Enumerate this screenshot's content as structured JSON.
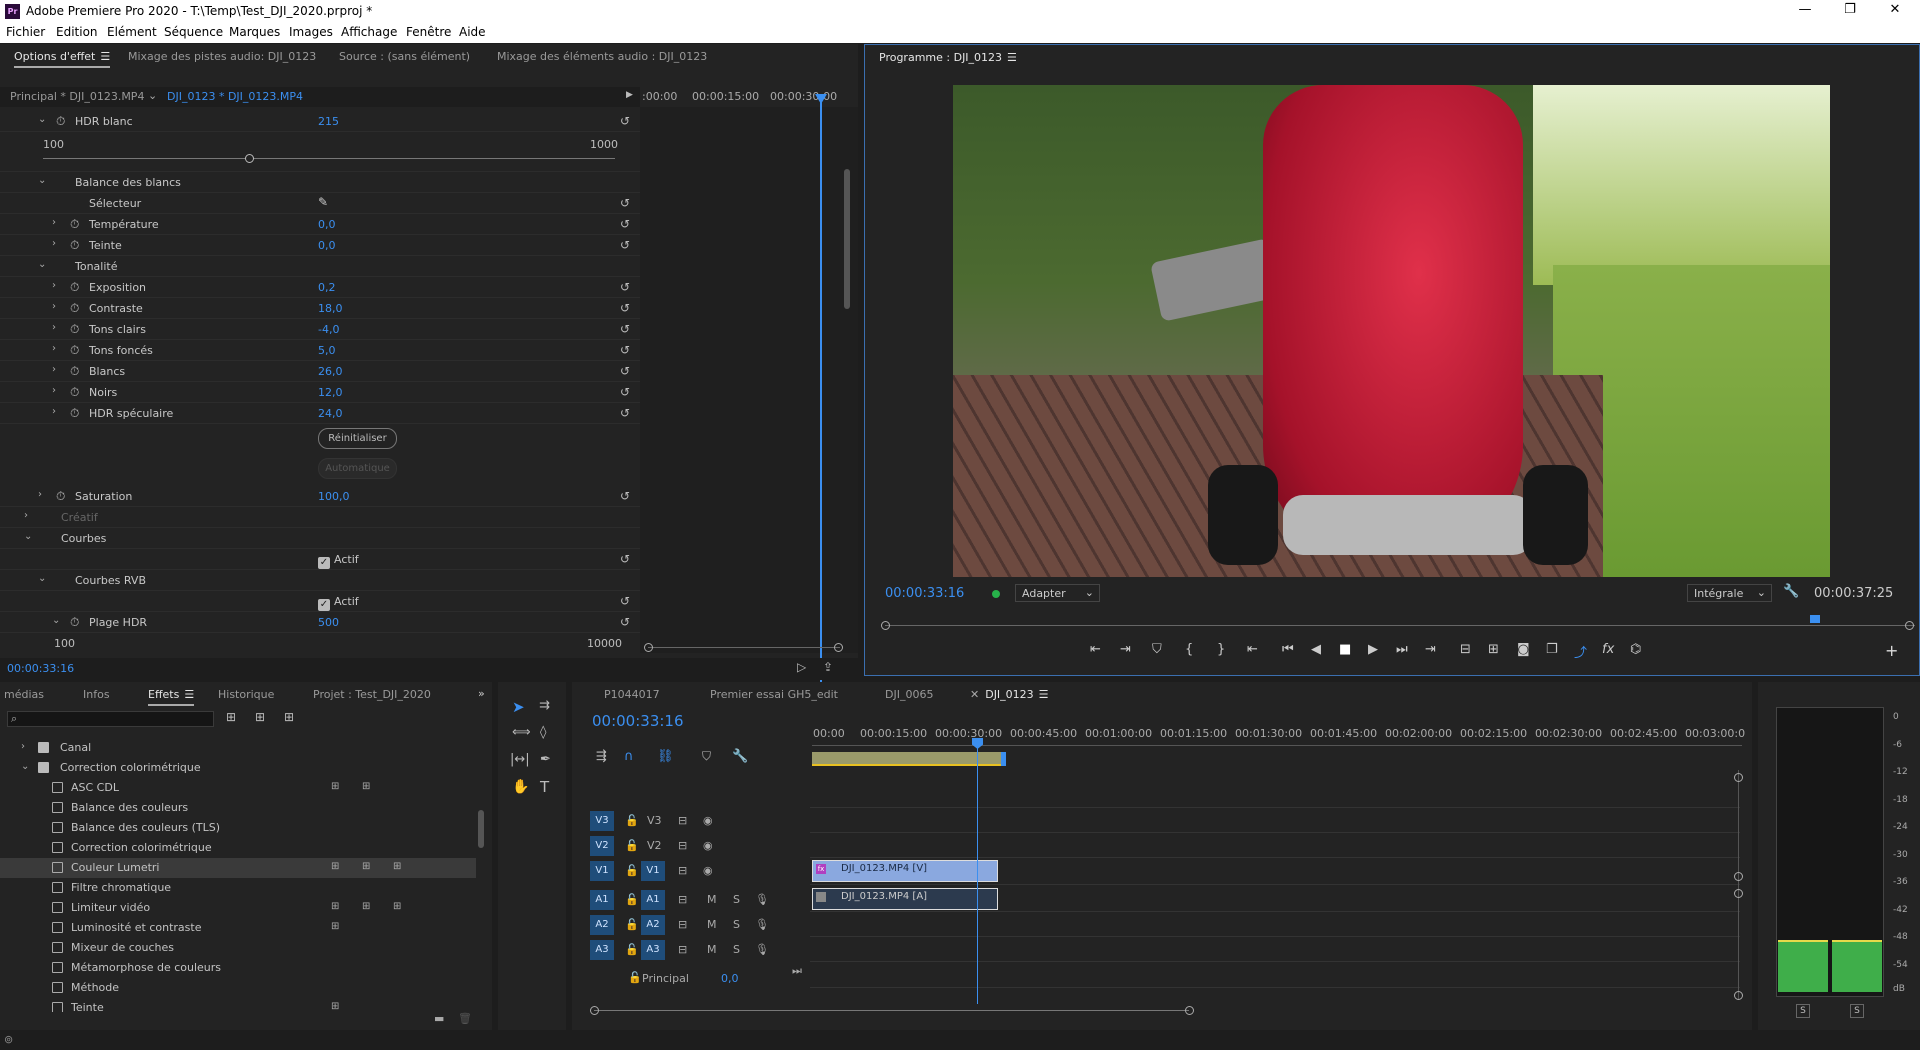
{
  "window": {
    "title": "Adobe Premiere Pro 2020 - T:\\Temp\\Test_DJI_2020.prproj *",
    "logo": "Pr",
    "minimize": "—",
    "maximize": "❐",
    "close": "✕"
  },
  "menu": [
    "Fichier",
    "Edition",
    "Elément",
    "Séquence",
    "Marques",
    "Images",
    "Affichage",
    "Fenêtre",
    "Aide"
  ],
  "effect_panel": {
    "tabs": [
      "Options d'effet",
      "Mixage des pistes audio: DJI_0123",
      "Source : (sans élément)",
      "Mixage des éléments audio : DJI_0123"
    ],
    "clip_master": "Principal * DJI_0123.MP4",
    "clip_seq": "DJI_0123 * DJI_0123.MP4",
    "tc0": ":00:00",
    "tc1": "00:00:15:00",
    "tc2": "00:00:30:00",
    "rows": {
      "hdr_blanc": {
        "label": "HDR blanc",
        "value": "215",
        "min": "100",
        "max": "1000"
      },
      "balance": "Balance des blancs",
      "selecteur": "Sélecteur",
      "temperature": {
        "label": "Température",
        "value": "0,0"
      },
      "teinte": {
        "label": "Teinte",
        "value": "0,0"
      },
      "tonalite": "Tonalité",
      "exposition": {
        "label": "Exposition",
        "value": "0,2"
      },
      "contraste": {
        "label": "Contraste",
        "value": "18,0"
      },
      "tons_clairs": {
        "label": "Tons clairs",
        "value": "-4,0"
      },
      "tons_fonces": {
        "label": "Tons foncés",
        "value": "5,0"
      },
      "blancs": {
        "label": "Blancs",
        "value": "26,0"
      },
      "noirs": {
        "label": "Noirs",
        "value": "12,0"
      },
      "hdr_spec": {
        "label": "HDR spéculaire",
        "value": "24,0"
      },
      "reset_btn": "Réinitialiser",
      "auto_btn": "Automatique",
      "saturation": {
        "label": "Saturation",
        "value": "100,0"
      },
      "creatif": "Créatif",
      "courbes": "Courbes",
      "actif1": "Actif",
      "courbes_rvb": "Courbes RVB",
      "actif2": "Actif",
      "plage_hdr": {
        "label": "Plage HDR",
        "value": "500",
        "min": "100",
        "max": "10000"
      }
    },
    "timecode": "00:00:33:16"
  },
  "program": {
    "tab": "Programme : DJI_0123",
    "timecode": "00:00:33:16",
    "zoom": "Adapter",
    "quality": "Intégrale",
    "duration": "00:00:37:25",
    "playhead_fraction": 0.903
  },
  "effects_browser": {
    "tabs": [
      "médias",
      "Infos",
      "Effets",
      "Historique",
      "Projet : Test_DJI_2020"
    ],
    "folders": [
      "Canal",
      "Correction colorimétrique"
    ],
    "items": [
      "ASC CDL",
      "Balance des couleurs",
      "Balance des couleurs (TLS)",
      "Correction colorimétrique",
      "Couleur Lumetri",
      "Filtre chromatique",
      "Limiteur vidéo",
      "Luminosité et contraste",
      "Mixeur de couches",
      "Métamorphose de couleurs",
      "Méthode",
      "Teinte"
    ]
  },
  "timeline": {
    "tabs": [
      "P1044017",
      "Premier essai GH5_edit",
      "DJI_0065",
      "DJI_0123"
    ],
    "timecode": "00:00:33:16",
    "ruler": [
      "00:00",
      "00:00:15:00",
      "00:00:30:00",
      "00:00:45:00",
      "00:01:00:00",
      "00:01:15:00",
      "00:01:30:00",
      "00:01:45:00",
      "00:02:00:00",
      "00:02:15:00",
      "00:02:30:00",
      "00:02:45:00",
      "00:03:00:0"
    ],
    "tracks_v": [
      "V3",
      "V2",
      "V1"
    ],
    "tracks_a": [
      "A1",
      "A2",
      "A3"
    ],
    "clip_v": "DJI_0123.MP4 [V]",
    "clip_a": "DJI_0123.MP4 [A]",
    "principal": "Principal",
    "principal_val": "0,0"
  },
  "meter": {
    "scale": [
      "0",
      "-6",
      "-12",
      "-18",
      "-24",
      "-30",
      "-36",
      "-42",
      "-48",
      "-54",
      "dB"
    ],
    "solo": "S"
  },
  "colors": {
    "accent": "#3b8ff0",
    "track": "#1f4d7a",
    "clip_v": "#8aa8df",
    "meter": "#3fae4a"
  }
}
